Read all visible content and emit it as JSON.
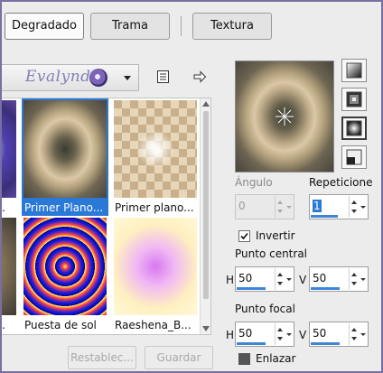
{
  "tabs": [
    {
      "label": "Degradado"
    },
    {
      "label": "Trama"
    },
    {
      "label": "Textura"
    }
  ],
  "logo": {
    "text": "Evalynda"
  },
  "thumbnails": [
    {
      "name": "Primer Plano..."
    },
    {
      "name": "Primer plano..."
    },
    {
      "name": "Puesta de sol"
    },
    {
      "name": "Raeshena_B..."
    }
  ],
  "buttons": {
    "reset": "Restablec...",
    "save": "Guardar"
  },
  "angle": {
    "label": "Ángulo",
    "value": "0"
  },
  "repetitions": {
    "label": "Repeticione",
    "value": "1"
  },
  "invert": {
    "label": "Invertir",
    "checked": true
  },
  "center_point": {
    "label": "Punto central",
    "h_label": "H",
    "h": "50",
    "v_label": "V",
    "v": "50"
  },
  "focal_point": {
    "label": "Punto focal",
    "h_label": "H",
    "h": "50",
    "v_label": "V",
    "v": "50"
  },
  "link": {
    "label": "Enlazar",
    "checked": false
  },
  "colors": {
    "accent": "#2b79d6",
    "frame": "#7a6fa0",
    "panel": "#ececec"
  }
}
